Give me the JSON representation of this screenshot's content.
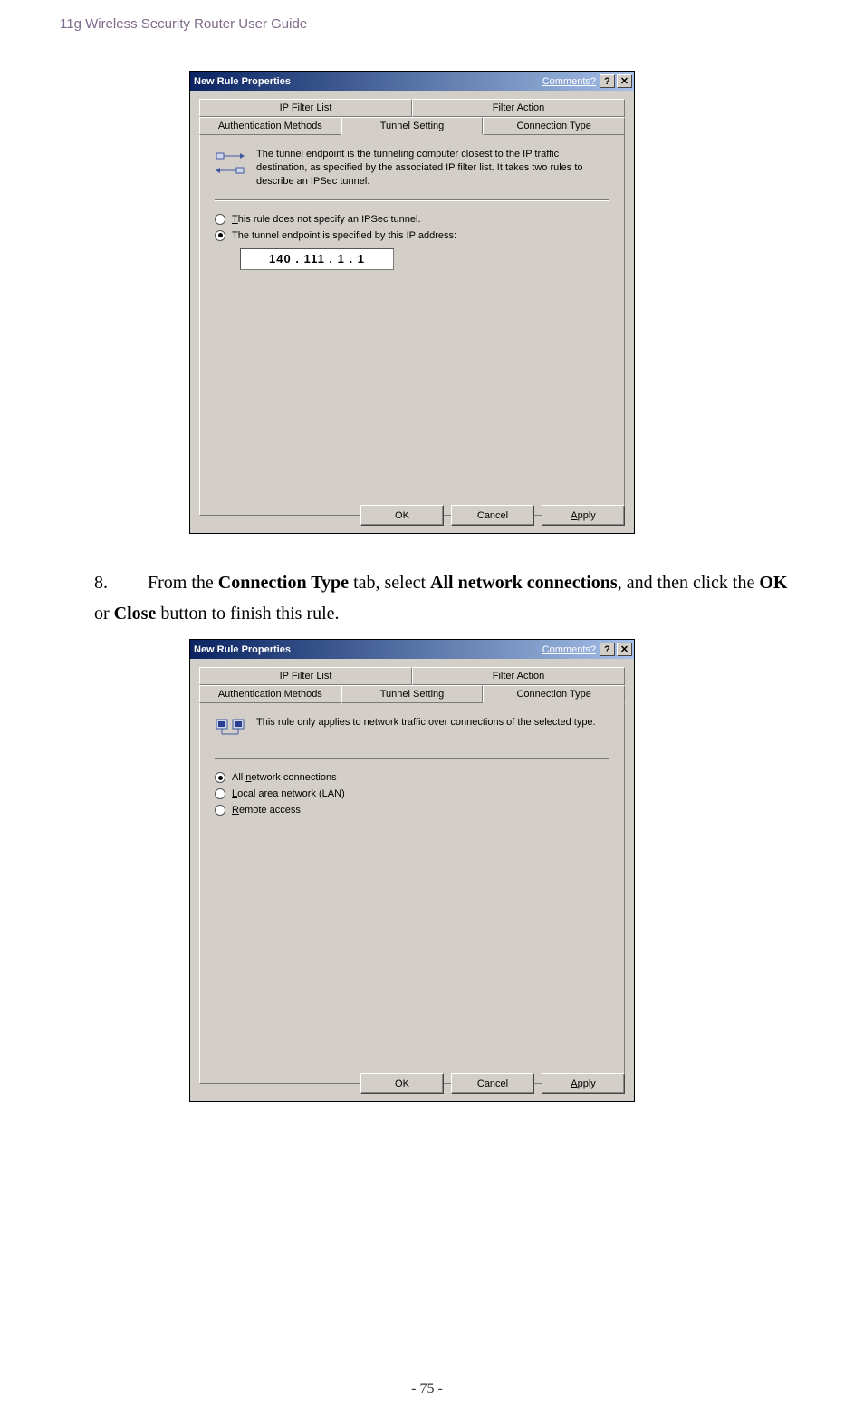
{
  "document": {
    "header": "11g Wireless Security Router User Guide",
    "footer": "- 75 -"
  },
  "step8": {
    "number": "8.",
    "pre1": "From the ",
    "b1": "Connection Type",
    "mid1": " tab, select ",
    "b2": "All network connections",
    "mid2": ", and then click the ",
    "b3": "OK",
    "mid3": " or ",
    "b4": "Close",
    "post": " button to finish this rule."
  },
  "dlg1": {
    "title": "New Rule Properties",
    "comments": "Comments?",
    "tabs_row1": {
      "left": "IP Filter List",
      "right": "Filter Action"
    },
    "tabs_row2": {
      "t1": "Authentication Methods",
      "t2": "Tunnel Setting",
      "t3": "Connection Type"
    },
    "info": "The tunnel endpoint is the tunneling computer closest to the IP traffic destination, as specified by the associated IP filter list. It takes two rules to describe an IPSec tunnel.",
    "radio1_pre": "T",
    "radio1_rest": "his rule does not specify an IPSec tunnel.",
    "radio2": "The tunnel endpoint is specified by this IP address:",
    "ip": "140 . 111 .   1   .   1",
    "buttons": {
      "ok": "OK",
      "cancel": "Cancel",
      "apply_pre": "A",
      "apply_rest": "pply"
    }
  },
  "dlg2": {
    "title": "New Rule Properties",
    "comments": "Comments?",
    "tabs_row1": {
      "left": "IP Filter List",
      "right": "Filter Action"
    },
    "tabs_row2": {
      "t1": "Authentication Methods",
      "t2": "Tunnel Setting",
      "t3": "Connection Type"
    },
    "info": "This rule only applies to network traffic over connections of the selected type.",
    "r1_pre": "All ",
    "r1_u": "n",
    "r1_rest": "etwork connections",
    "r2_u": "L",
    "r2_rest": "ocal area network (LAN)",
    "r3_u": "R",
    "r3_rest": "emote access",
    "buttons": {
      "ok": "OK",
      "cancel": "Cancel",
      "apply_pre": "A",
      "apply_rest": "pply"
    }
  }
}
